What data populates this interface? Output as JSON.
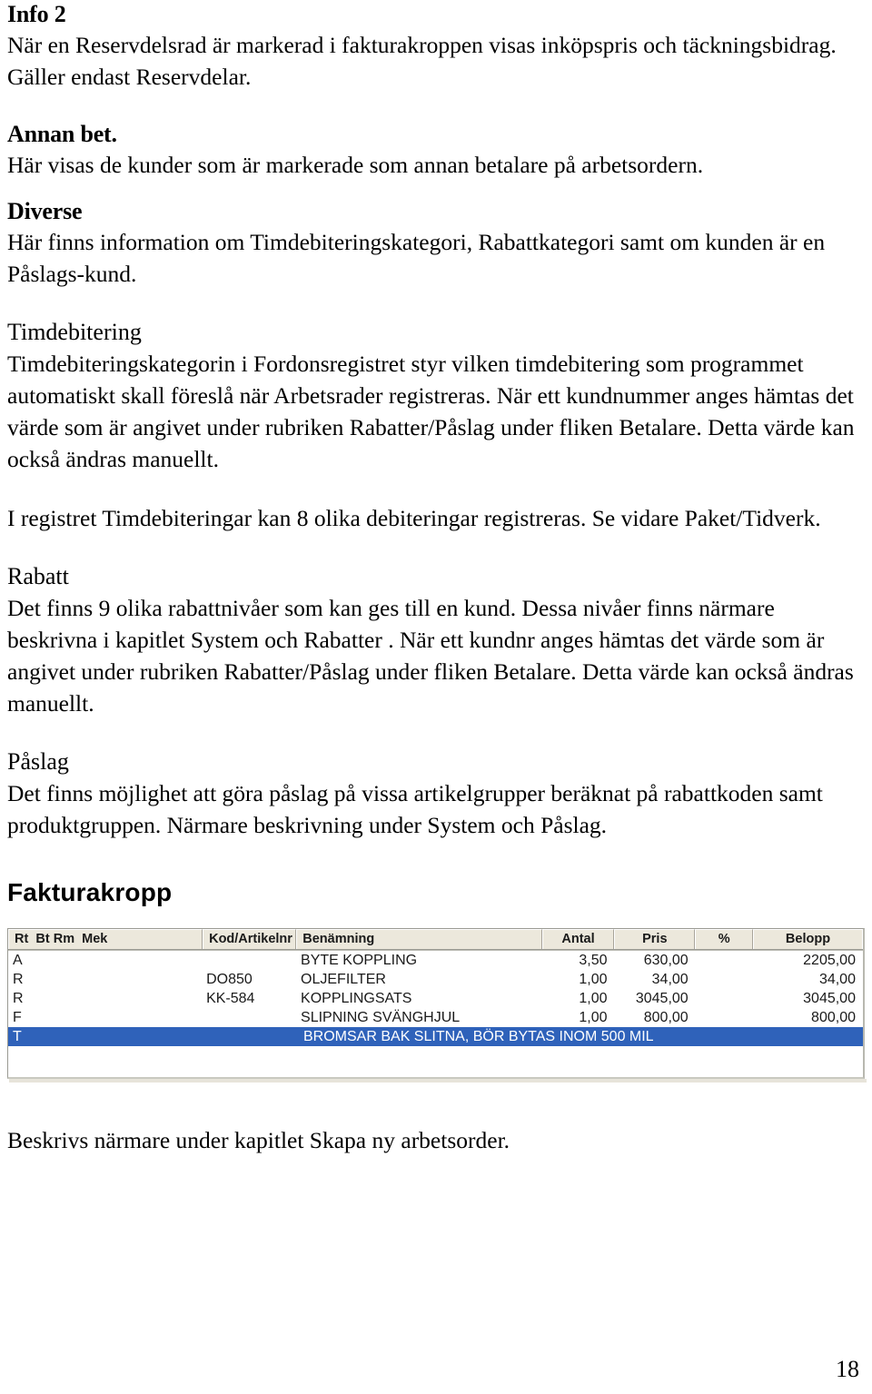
{
  "document": {
    "page_number": "18"
  },
  "sections": [
    {
      "id": "info2",
      "heading": "Info 2",
      "heading_style": "bold",
      "body": "När en Reservdelsrad är markerad i fakturakroppen visas inköpspris och täckningsbidrag. Gäller endast Reservdelar."
    },
    {
      "id": "annan_bet",
      "heading": "Annan bet.",
      "heading_style": "bold",
      "body": "Här visas de kunder som är markerade som annan betalare på arbetsordern."
    },
    {
      "id": "diverse",
      "heading": "Diverse",
      "heading_style": "bold",
      "body": "Här finns information om Timdebiteringskategori, Rabattkategori samt om kunden är en Påslags-kund."
    },
    {
      "id": "timdebitering",
      "heading": "Timdebitering",
      "heading_style": "plain",
      "body": "Timdebiteringskategorin i Fordonsregistret styr vilken timdebitering som programmet automatiskt skall föreslå när Arbetsrader registreras. När ett kundnummer anges hämtas det värde som är angivet under rubriken Rabatter/Påslag under fliken Betalare. Detta värde kan också ändras manuellt.",
      "body2": "I registret Timdebiteringar kan 8 olika debiteringar registreras. Se vidare Paket/Tidverk."
    },
    {
      "id": "rabatt",
      "heading": "Rabatt",
      "heading_style": "plain",
      "body": "Det finns 9 olika rabattnivåer som kan ges till en kund. Dessa nivåer finns närmare beskrivna i kapitlet System och Rabatter . När ett kundnr anges hämtas det värde som är angivet under rubriken Rabatter/Påslag under fliken Betalare. Detta värde kan också ändras manuellt."
    },
    {
      "id": "paslag",
      "heading": "Påslag",
      "heading_style": "plain",
      "body": "Det finns möjlighet att göra påslag på vissa artikelgrupper beräknat på rabattkoden samt produktgruppen. Närmare beskrivning under System och Påslag."
    }
  ],
  "fakturakropp": {
    "heading": "Fakturakropp",
    "caption": "Beskrivs närmare under kapitlet Skapa ny arbetsorder.",
    "colors": {
      "header_bg": "#ece8dc",
      "selection_bg": "#2f62ba",
      "selection_text": "#ffffff",
      "border": "#9a9a93"
    },
    "columns": [
      {
        "key": "rt",
        "label": "Rt",
        "align": "left"
      },
      {
        "key": "bt",
        "label": "Bt",
        "align": "left"
      },
      {
        "key": "rm",
        "label": "Rm",
        "align": "left"
      },
      {
        "key": "mek",
        "label": "Mek",
        "align": "left"
      },
      {
        "key": "kod",
        "label": "Kod/Artikelnr",
        "align": "left"
      },
      {
        "key": "benamning",
        "label": "Benämning",
        "align": "left"
      },
      {
        "key": "antal",
        "label": "Antal",
        "align": "right"
      },
      {
        "key": "pris",
        "label": "Pris",
        "align": "right"
      },
      {
        "key": "procent",
        "label": "%",
        "align": "right"
      },
      {
        "key": "belopp",
        "label": "Belopp",
        "align": "right"
      }
    ],
    "rows": [
      {
        "rt": "A",
        "bt": "",
        "rm": "",
        "mek": "",
        "kod": "",
        "benamning": "BYTE KOPPLING",
        "antal": "3,50",
        "pris": "630,00",
        "procent": "",
        "belopp": "2205,00",
        "selected": false
      },
      {
        "rt": "R",
        "bt": "",
        "rm": "",
        "mek": "",
        "kod": "DO850",
        "benamning": "OLJEFILTER",
        "antal": "1,00",
        "pris": "34,00",
        "procent": "",
        "belopp": "34,00",
        "selected": false
      },
      {
        "rt": "R",
        "bt": "",
        "rm": "",
        "mek": "",
        "kod": "KK-584",
        "benamning": "KOPPLINGSATS",
        "antal": "1,00",
        "pris": "3045,00",
        "procent": "",
        "belopp": "3045,00",
        "selected": false
      },
      {
        "rt": "F",
        "bt": "",
        "rm": "",
        "mek": "",
        "kod": "",
        "benamning": "SLIPNING SVÄNGHJUL",
        "antal": "1,00",
        "pris": "800,00",
        "procent": "",
        "belopp": "800,00",
        "selected": false
      },
      {
        "rt": "T",
        "bt": "",
        "rm": "",
        "mek": "",
        "kod": "",
        "benamning": "BROMSAR BAK SLITNA, BÖR BYTAS INOM 500 MIL",
        "antal": "",
        "pris": "",
        "procent": "",
        "belopp": "",
        "selected": true
      }
    ]
  }
}
